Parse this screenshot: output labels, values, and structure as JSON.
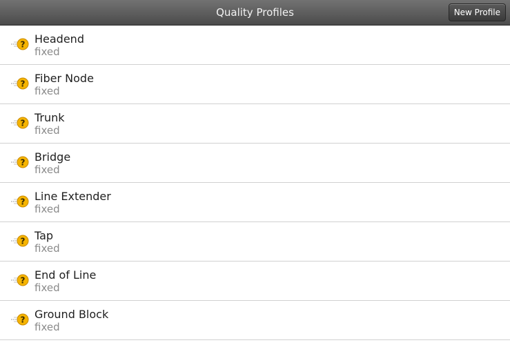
{
  "header": {
    "title": "Quality Profiles",
    "new_profile_label": "New Profile"
  },
  "profiles": [
    {
      "name": "Headend",
      "type": "fixed",
      "icon": "unknown-status-key-icon"
    },
    {
      "name": "Fiber Node",
      "type": "fixed",
      "icon": "unknown-status-key-icon"
    },
    {
      "name": "Trunk",
      "type": "fixed",
      "icon": "unknown-status-key-icon"
    },
    {
      "name": "Bridge",
      "type": "fixed",
      "icon": "unknown-status-key-icon"
    },
    {
      "name": "Line Extender",
      "type": "fixed",
      "icon": "unknown-status-key-icon"
    },
    {
      "name": "Tap",
      "type": "fixed",
      "icon": "unknown-status-key-icon"
    },
    {
      "name": "End of Line",
      "type": "fixed",
      "icon": "unknown-status-key-icon"
    },
    {
      "name": "Ground Block",
      "type": "fixed",
      "icon": "unknown-status-key-icon"
    }
  ],
  "colors": {
    "header_bg": "#5a5a5a",
    "icon_circle": "#f5b400",
    "icon_mark": "#3a2a00",
    "divider": "#d0d0d0"
  }
}
